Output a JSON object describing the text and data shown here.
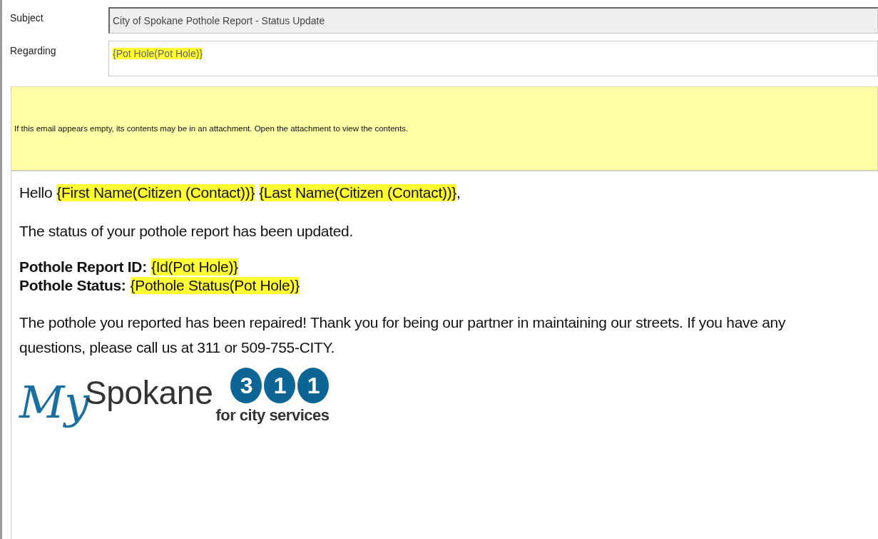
{
  "header": {
    "subject": {
      "label": "Subject",
      "value": "City of Spokane Pothole Report - Status Update"
    },
    "regarding": {
      "label": "Regarding",
      "value": "{Pot Hole(Pot Hole)}"
    }
  },
  "notice": "If this email appears empty, its contents may be in an attachment. Open the attachment to view the contents.",
  "body": {
    "greeting": {
      "word": "Hello",
      "placeholders": [
        "{First Name(Citizen (Contact))}",
        "{Last Name(Citizen (Contact))}"
      ],
      "end": ","
    },
    "intro": "The status of your pothole report has been updated.",
    "details": [
      {
        "label": "Pothole Report ID:",
        "value": "{Id(Pot Hole)}"
      },
      {
        "label": "Pothole Status:",
        "value": "{Pothole Status(Pot Hole)}"
      }
    ],
    "message": "The pothole you reported has been repaired! Thank you for being our partner in maintaining our streets. If you have any questions, please call us at 311 or 509-755-CITY.",
    "logo": {
      "script": "My",
      "name": "Spokane",
      "digits": [
        "3",
        "1",
        "1"
      ],
      "tagline": "for city services"
    }
  }
}
